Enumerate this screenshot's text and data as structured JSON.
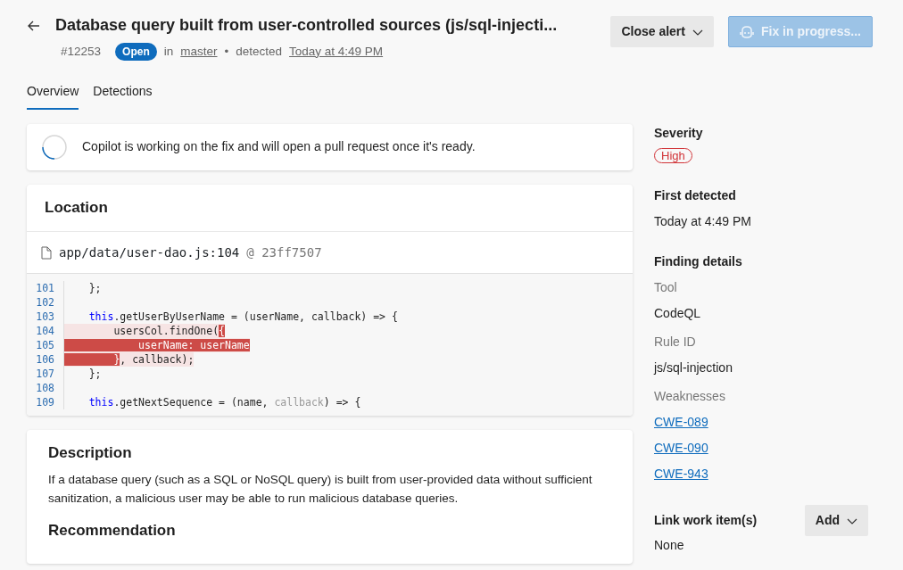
{
  "header": {
    "title": "Database query built from user-controlled sources (js/sql-injecti...",
    "alert_id": "#12253",
    "status": "Open",
    "in_label": "in",
    "branch": "master",
    "separator": "•",
    "detected_label": "detected",
    "detected_time": "Today at 4:49 PM",
    "close_button": "Close alert",
    "fix_button": {
      "label": "Fix in progress...",
      "disabled": true
    }
  },
  "tabs": [
    {
      "label": "Overview",
      "selected": true
    },
    {
      "label": "Detections",
      "selected": false
    }
  ],
  "copilot_notice": "Copilot is working on the fix and will open a pull request once it's ready.",
  "location": {
    "heading": "Location",
    "file": "app/data/user-dao.js:104",
    "commit": "@ 23ff7507",
    "lines": [
      {
        "number": "101",
        "in_range": false,
        "segments": [
          {
            "text": "    };",
            "kind": "plain"
          }
        ]
      },
      {
        "number": "102"
      },
      {
        "number": "103",
        "in_range": false,
        "segments": [
          {
            "text": "    this",
            "kind": "keyword"
          },
          {
            "text": ".getUserByUserName = (userName, callback) => {",
            "kind": "plain"
          }
        ]
      },
      {
        "number": "104",
        "in_range": true,
        "segments": [
          {
            "text": "        usersCol.findOne(",
            "kind": "plain"
          },
          {
            "text": "{",
            "kind": "flagged"
          }
        ]
      },
      {
        "number": "105",
        "in_range": true,
        "segments": [
          {
            "text": "            userName: userName",
            "kind": "flagged"
          }
        ]
      },
      {
        "number": "106",
        "in_range": true,
        "segments": [
          {
            "text": "        }",
            "kind": "flagged"
          },
          {
            "text": ", callback);",
            "kind": "plain"
          }
        ]
      },
      {
        "number": "107",
        "in_range": false,
        "segments": [
          {
            "text": "    };",
            "kind": "plain"
          }
        ]
      },
      {
        "number": "108"
      },
      {
        "number": "109",
        "in_range": false,
        "segments": [
          {
            "text": "    this",
            "kind": "keyword"
          },
          {
            "text": ".getNextSequence = (name, ",
            "kind": "plain"
          },
          {
            "text": "callback",
            "kind": "muted"
          },
          {
            "text": ") => {",
            "kind": "plain"
          }
        ]
      }
    ]
  },
  "description": {
    "heading": "Description",
    "text": "If a database query (such as a SQL or NoSQL query) is built from user-provided data without sufficient sanitization, a malicious user may be able to run malicious database queries.",
    "next_heading": "Recommendation"
  },
  "sidebar": {
    "severity_label": "Severity",
    "severity": "High",
    "first_detected_label": "First detected",
    "first_detected": "Today at 4:49 PM",
    "finding_label": "Finding details",
    "tool_label": "Tool",
    "tool": "CodeQL",
    "rule_label": "Rule ID",
    "rule": "js/sql-injection",
    "weaknesses_label": "Weaknesses",
    "weaknesses": [
      "CWE-089",
      "CWE-090",
      "CWE-943"
    ],
    "work_items_label": "Link work item(s)",
    "add_button": "Add",
    "work_items": "None"
  }
}
